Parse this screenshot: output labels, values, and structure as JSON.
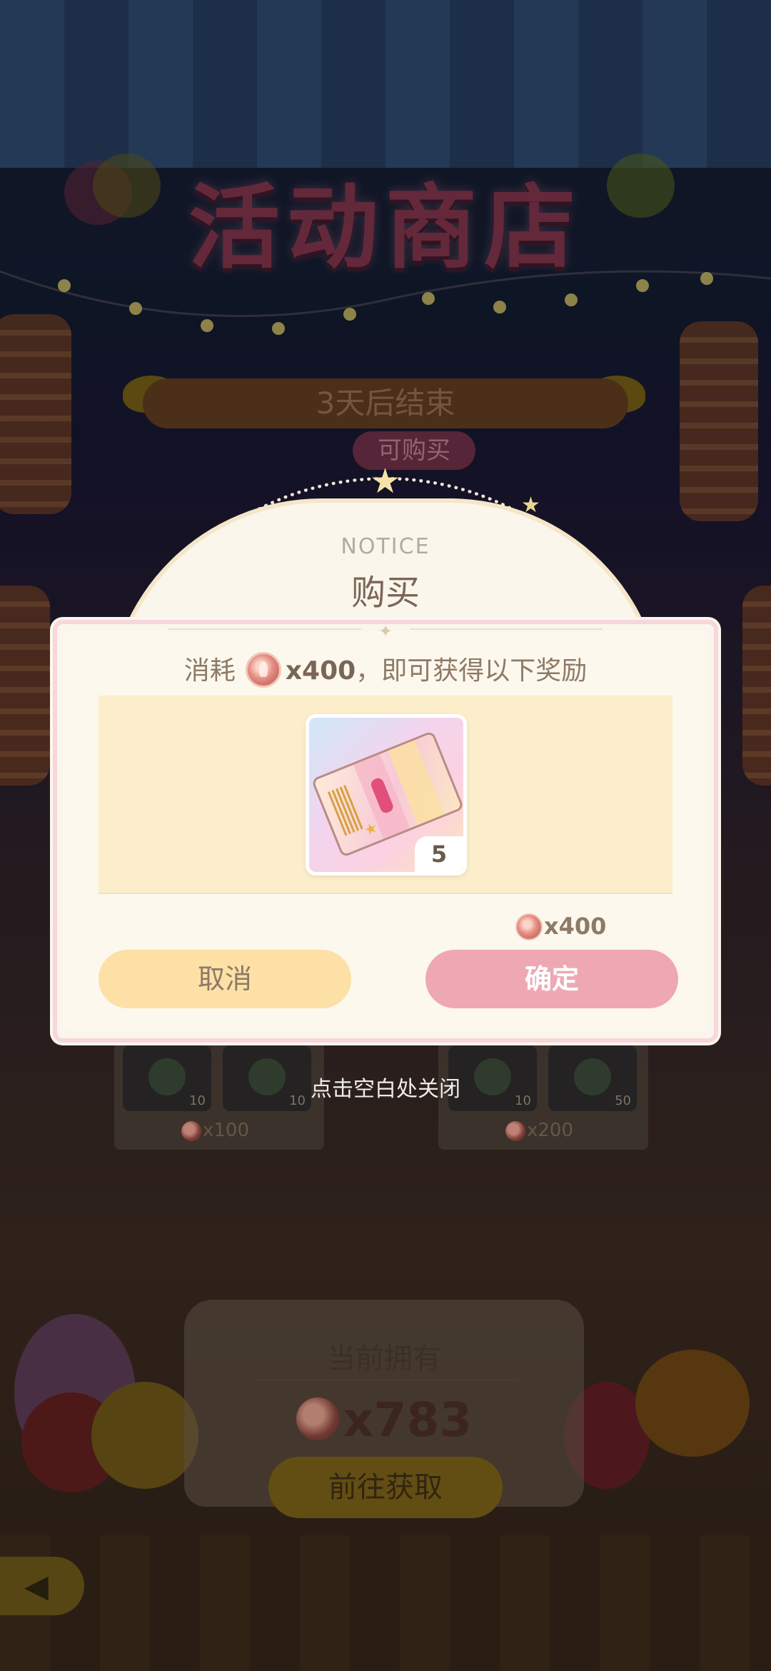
{
  "shop": {
    "title": "活动商店",
    "end_banner": "3天后结束",
    "buy_tag": "可购买",
    "cards": [
      {
        "slots": [
          "10",
          "10"
        ],
        "price": "x100"
      },
      {
        "slots": [
          "10",
          "50"
        ],
        "price": "x200"
      }
    ],
    "own": {
      "title": "当前拥有",
      "amount": "x783",
      "goto_button": "前往获取"
    },
    "back_icon": "back-arrow-icon"
  },
  "dialog": {
    "notice_en": "NOTICE",
    "title": "购买",
    "cost_prefix": "消耗",
    "cost_amount": "x400",
    "cost_suffix": "，即可获得以下奖励",
    "reward": {
      "icon": "ticket-icon",
      "quantity": "5"
    },
    "total": "x400",
    "cancel_label": "取消",
    "confirm_label": "确定",
    "close_hint": "点击空白处关闭"
  },
  "colors": {
    "confirm": "#eea8b4",
    "cancel": "#fde0a6",
    "dialog_bg": "#fbf6ec",
    "reward_bg": "#fdeecb"
  }
}
